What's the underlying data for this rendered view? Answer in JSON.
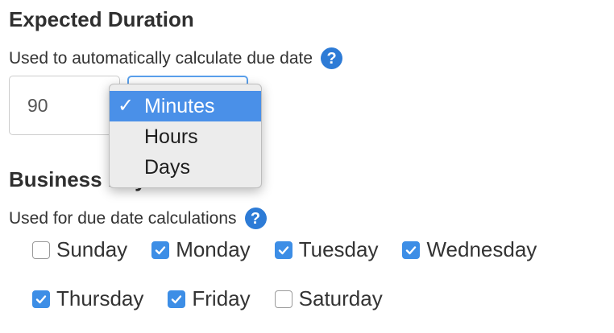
{
  "expected_duration": {
    "title": "Expected Duration",
    "help_text": "Used to automatically calculate due date",
    "help_icon": "question-circle-icon",
    "value": "90",
    "unit_options": [
      "Minutes",
      "Hours",
      "Days"
    ],
    "selected_unit": "Minutes",
    "check_glyph": "✓"
  },
  "business_days": {
    "title": "Business Days",
    "help_text": "Used for due date calculations",
    "help_icon": "question-circle-icon",
    "days": [
      {
        "label": "Sunday",
        "checked": false
      },
      {
        "label": "Monday",
        "checked": true
      },
      {
        "label": "Tuesday",
        "checked": true
      },
      {
        "label": "Wednesday",
        "checked": true
      },
      {
        "label": "Thursday",
        "checked": true
      },
      {
        "label": "Friday",
        "checked": true
      },
      {
        "label": "Saturday",
        "checked": false
      }
    ]
  },
  "colors": {
    "accent": "#3d8ee6",
    "selected_option": "#4a90e8",
    "help_icon": "#2d7bd6"
  }
}
